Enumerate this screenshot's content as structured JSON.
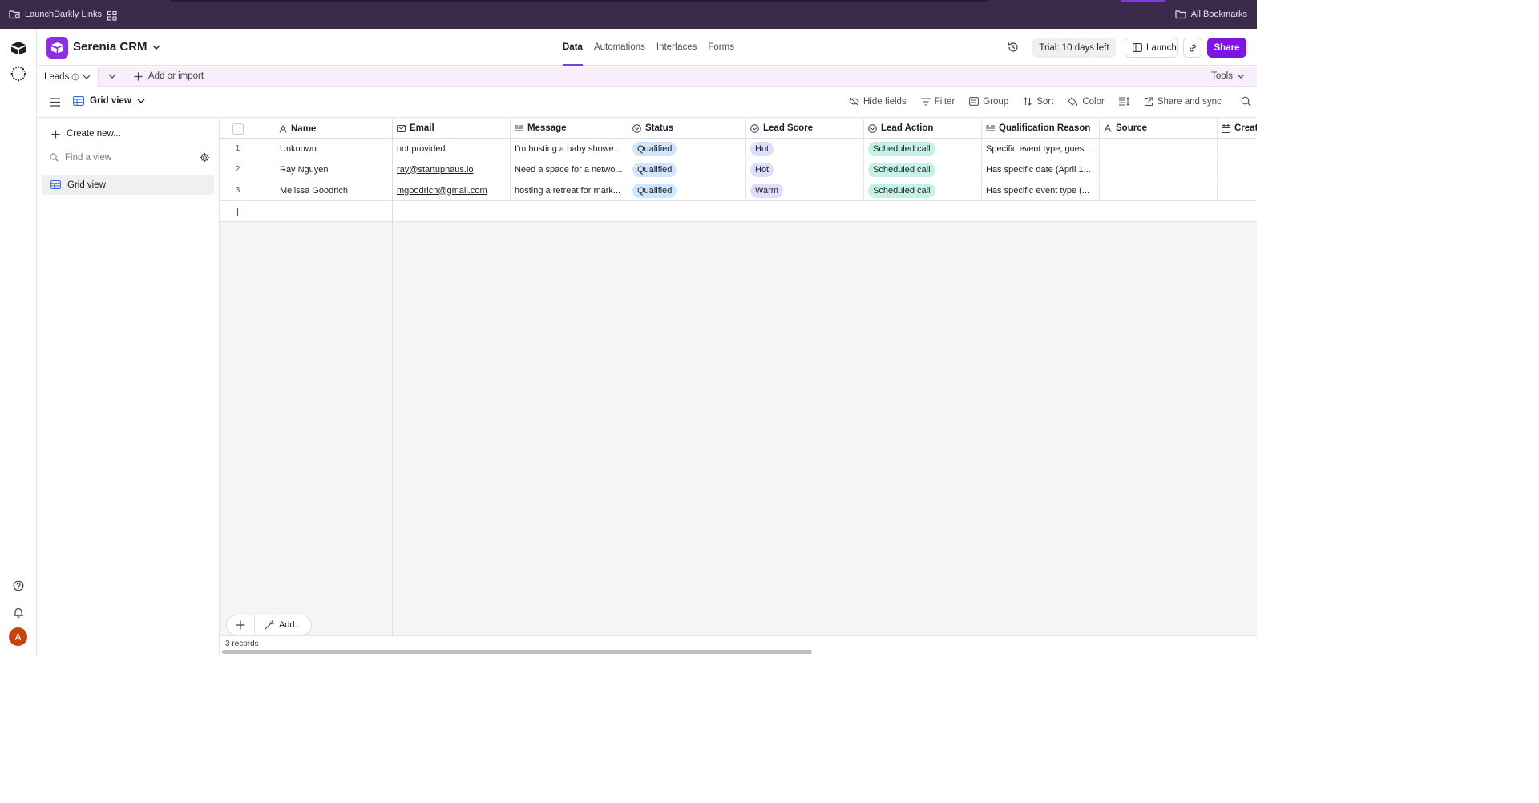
{
  "bookmarks": {
    "left_label": "LaunchDarkly Links",
    "right_label": "All Bookmarks"
  },
  "base": {
    "name": "Serenia CRM"
  },
  "nav": {
    "tabs": [
      "Data",
      "Automations",
      "Interfaces",
      "Forms"
    ],
    "active": "Data"
  },
  "header": {
    "trial": "Trial: 10 days left",
    "launch": "Launch",
    "share": "Share"
  },
  "tables": {
    "active": "Leads",
    "add_import": "Add or import",
    "tools": "Tools"
  },
  "view": {
    "name": "Grid view",
    "toolbar": [
      "Hide fields",
      "Filter",
      "Group",
      "Sort",
      "Color",
      "Share and sync"
    ]
  },
  "sidebar": {
    "create_new": "Create new...",
    "find_placeholder": "Find a view",
    "views": [
      "Grid view"
    ]
  },
  "grid": {
    "columns": [
      "Name",
      "Email",
      "Message",
      "Status",
      "Lead Score",
      "Lead Action",
      "Qualification Reason",
      "Source",
      "Creat"
    ],
    "rows": [
      {
        "num": "1",
        "name": "Unknown",
        "email": "not provided",
        "email_link": false,
        "message": "I'm hosting a baby showe...",
        "status": "Qualified",
        "score": "Hot",
        "action": "Scheduled call",
        "reason": "Specific event type, gues...",
        "source": ""
      },
      {
        "num": "2",
        "name": "Ray Nguyen",
        "email": "ray@startuphaus.io",
        "email_link": true,
        "message": "Need a space for a netwo...",
        "status": "Qualified",
        "score": "Hot",
        "action": "Scheduled call",
        "reason": "Has specific date (April 1...",
        "source": ""
      },
      {
        "num": "3",
        "name": "Melissa Goodrich",
        "email": "mgoodrich@gmail.com",
        "email_link": true,
        "message": "hosting a retreat for mark...",
        "status": "Qualified",
        "score": "Warm",
        "action": "Scheduled call",
        "reason": "Has specific event type (...",
        "source": ""
      }
    ],
    "add_more": "Add...",
    "record_count": "3 records"
  },
  "user": {
    "avatar_initial": "A"
  },
  "colors": {
    "accent": "#7c3aed",
    "share_button": "#7c14e2",
    "base_icon": "#8b2fe0",
    "bookmarks_bar": "#3b2a4a",
    "tables_bar": "#f9eefb",
    "avatar": "#c4430f"
  }
}
